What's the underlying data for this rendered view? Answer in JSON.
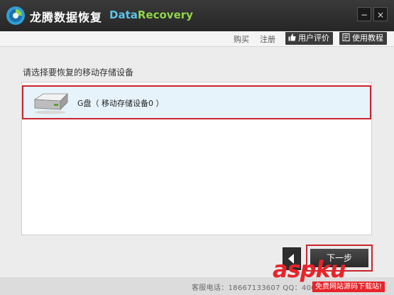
{
  "window": {
    "title": "龙腾数据恢复",
    "subtitle_part1": "Data",
    "subtitle_part2": "Recovery",
    "minimize_glyph": "−",
    "close_glyph": "×"
  },
  "toolbar": {
    "buy": "购买",
    "register": "注册",
    "user_review": "用户评价",
    "tutorial": "使用教程"
  },
  "main": {
    "prompt": "请选择要恢复的移动存储设备",
    "devices": [
      {
        "label": "G盘（ 移动存储设备0 ）",
        "icon": "removable-drive-icon",
        "selected": true
      }
    ]
  },
  "footer": {
    "contact": "客服电话：18667133607  QQ：40067133607",
    "next_label": "下一步",
    "back_glyph": "◀"
  },
  "watermark": {
    "brand": "aspku",
    "tagline": "免费网站源码下载站!"
  },
  "colors": {
    "highlight_red": "#c9252d",
    "title_blue": "#5bc3ea",
    "title_green": "#8fd34a",
    "watermark_red": "#e8242a"
  }
}
